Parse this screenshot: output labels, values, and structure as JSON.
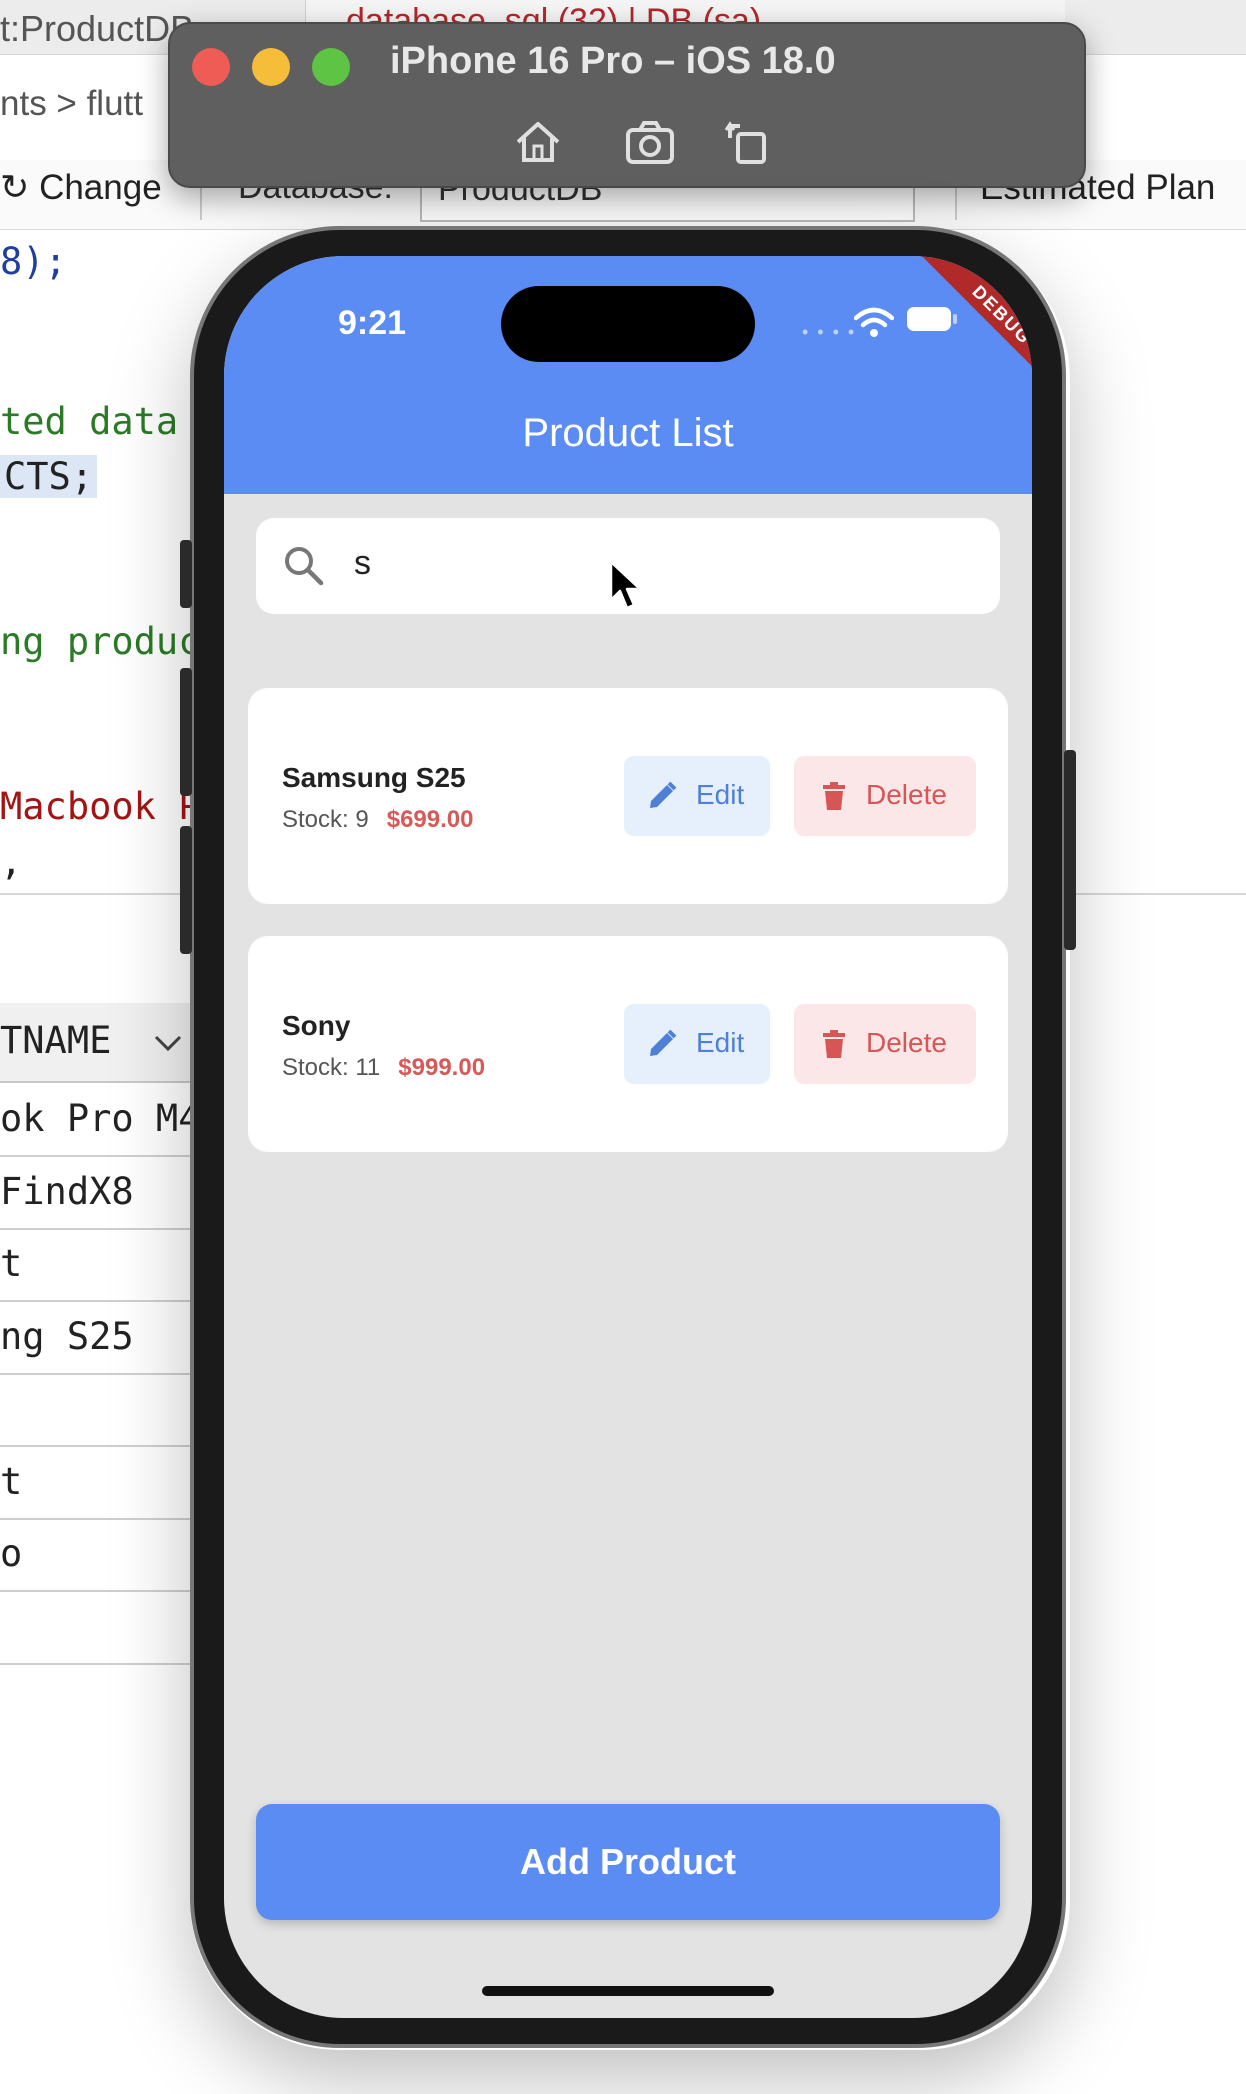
{
  "ide": {
    "tab_title": "t:ProductDB",
    "tab2_text": "database_sql (32) | DB (sa)",
    "tab_close": "✕",
    "breadcrumb": "nts  >  flutt",
    "toolbar": {
      "change_label": "Change",
      "database_label": "Database:",
      "database_value": "ProductDB",
      "estimated_label": "Estimated Plan"
    },
    "code": [
      {
        "text": "8);",
        "style": "c-blue"
      },
      {
        "text": "ted data",
        "style": "c-green"
      },
      {
        "text": "CTS;",
        "style": "c-dark c-hl"
      },
      {
        "text": "ng produc",
        "style": "c-green"
      },
      {
        "text": "Macbook P",
        "style": "c-red"
      },
      {
        "text": ",",
        "style": "c-dark"
      }
    ],
    "grid": {
      "header": "TNAME",
      "rows": [
        "ok Pro M4",
        "FindX8",
        "t",
        "ng S25",
        "",
        "t",
        "o",
        ""
      ]
    }
  },
  "simulator": {
    "title": "iPhone 16 Pro – iOS 18.0",
    "controls": [
      "home-icon",
      "screenshot-icon",
      "rotate-icon"
    ]
  },
  "app": {
    "status": {
      "time": "9:21",
      "debug_banner": "DEBUG"
    },
    "title": "Product List",
    "search": {
      "value": "s",
      "icon": "search-icon"
    },
    "products": [
      {
        "name": "Samsung S25",
        "stock_label": "Stock: 9",
        "price": "$699.00",
        "edit_label": "Edit",
        "delete_label": "Delete"
      },
      {
        "name": "Sony",
        "stock_label": "Stock: 11",
        "price": "$999.00",
        "edit_label": "Edit",
        "delete_label": "Delete"
      }
    ],
    "add_button_label": "Add Product",
    "colors": {
      "primary": "#5b8cf3",
      "price": "#d75a5a",
      "edit": "#4f7fd6",
      "delete": "#d85555"
    }
  }
}
